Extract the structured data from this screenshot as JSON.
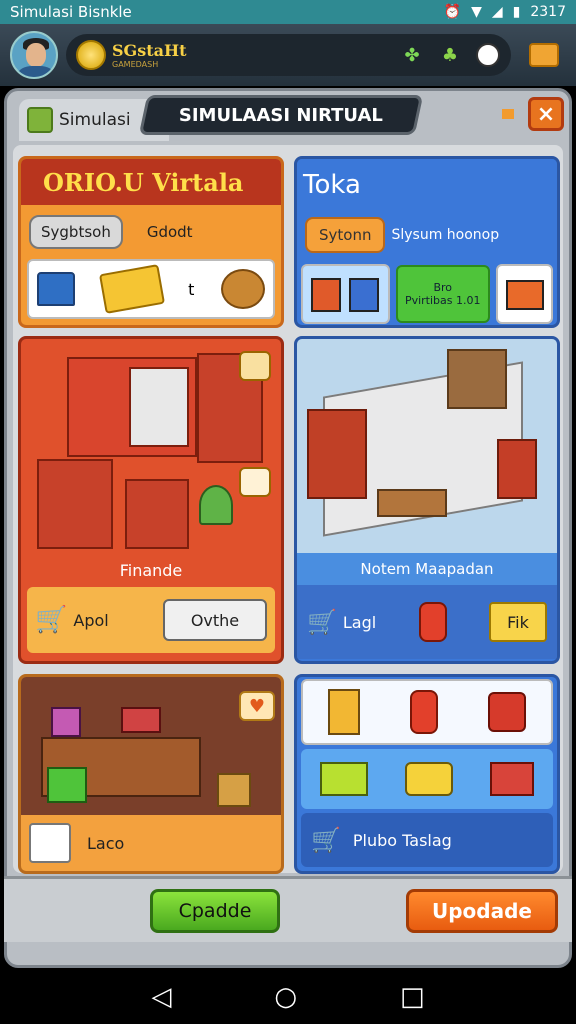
{
  "statusbar": {
    "title": "Simulasi Bisnkle",
    "time": "2317"
  },
  "header": {
    "username": "SGstaHt",
    "subtitle": "GAMEDASH"
  },
  "panel": {
    "tab_label": "Simulasi",
    "title": "SIMULAASI NIRTUAL",
    "close": "×"
  },
  "card_virtual": {
    "title": "ORIO.U Virtala",
    "pill": "Sygbtsoh",
    "side": "Gdodt",
    "slot_text": "t"
  },
  "card_toka": {
    "title": "Toka",
    "pill": "Sytonn",
    "side": "Slysum hoonop",
    "green_line1": "Bro",
    "green_line2": "Pvirtibas 1.01"
  },
  "card_finande": {
    "caption": "Finande",
    "cart_label": "Apol",
    "button": "Ovthe"
  },
  "card_store": {
    "caption": "Notem Maapadan",
    "left_label": "Lagl",
    "right_button": "Fik"
  },
  "card_items": {
    "label": "Laco"
  },
  "card_shop": {
    "label": "Plubo Taslag"
  },
  "buttons": {
    "left": "Cpadde",
    "right": "Upodade"
  },
  "colors": {
    "accent_orange": "#f39a33",
    "accent_blue": "#3b78d9",
    "accent_red": "#b8351e"
  }
}
